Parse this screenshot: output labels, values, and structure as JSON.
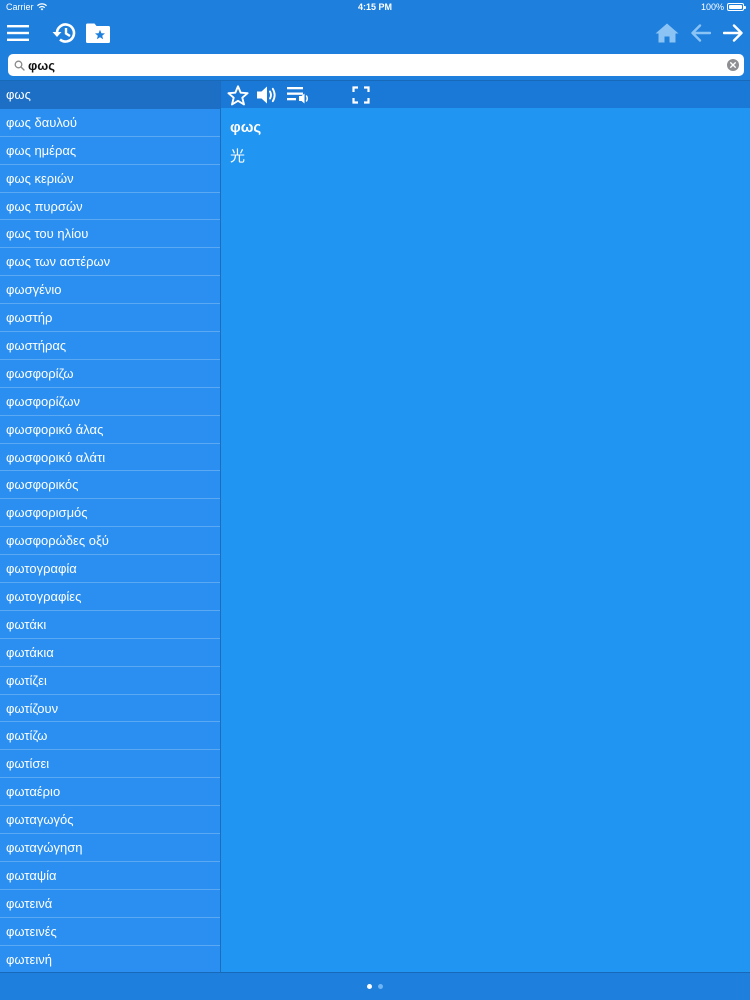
{
  "status_bar": {
    "carrier": "Carrier",
    "time": "4:15 PM",
    "battery": "100%"
  },
  "search": {
    "value": "φως"
  },
  "word_list": [
    "φως",
    "φως δαυλού",
    "φως ημέρας",
    "φως κεριών",
    "φως πυρσών",
    "φως του ηλίου",
    "φως των αστέρων",
    "φωσγένιο",
    "φωστήρ",
    "φωστήρας",
    "φωσφορίζω",
    "φωσφορίζων",
    "φωσφορικό άλας",
    "φωσφορικό αλάτι",
    "φωσφορικός",
    "φωσφορισμός",
    "φωσφορώδες οξύ",
    "φωτογραφία",
    "φωτογραφίες",
    "φωτάκι",
    "φωτάκια",
    "φωτίζει",
    "φωτίζουν",
    "φωτίζω",
    "φωτίσει",
    "φωταέριο",
    "φωταγωγός",
    "φωταγώγηση",
    "φωταψία",
    "φωτεινά",
    "φωτεινές",
    "φωτεινή"
  ],
  "selected_index": 0,
  "detail": {
    "headword": "φως",
    "translation": "光"
  },
  "icons": {
    "menu": "menu-icon",
    "history": "history-icon",
    "favorites_folder": "star-folder-icon",
    "home": "home-icon",
    "back": "back-arrow-icon",
    "forward": "forward-arrow-icon",
    "star": "star-icon",
    "speaker": "speaker-icon",
    "playlist": "playlist-audio-icon",
    "fullscreen": "fullscreen-icon"
  },
  "colors": {
    "primary": "#1e7fdc",
    "list_background": "#2a8ff0",
    "detail_background": "#2195f2",
    "selected_row": "#1c6fc5",
    "disabled_icon": "#8cc3f5"
  },
  "pagination": {
    "pages": 2,
    "current": 1
  }
}
